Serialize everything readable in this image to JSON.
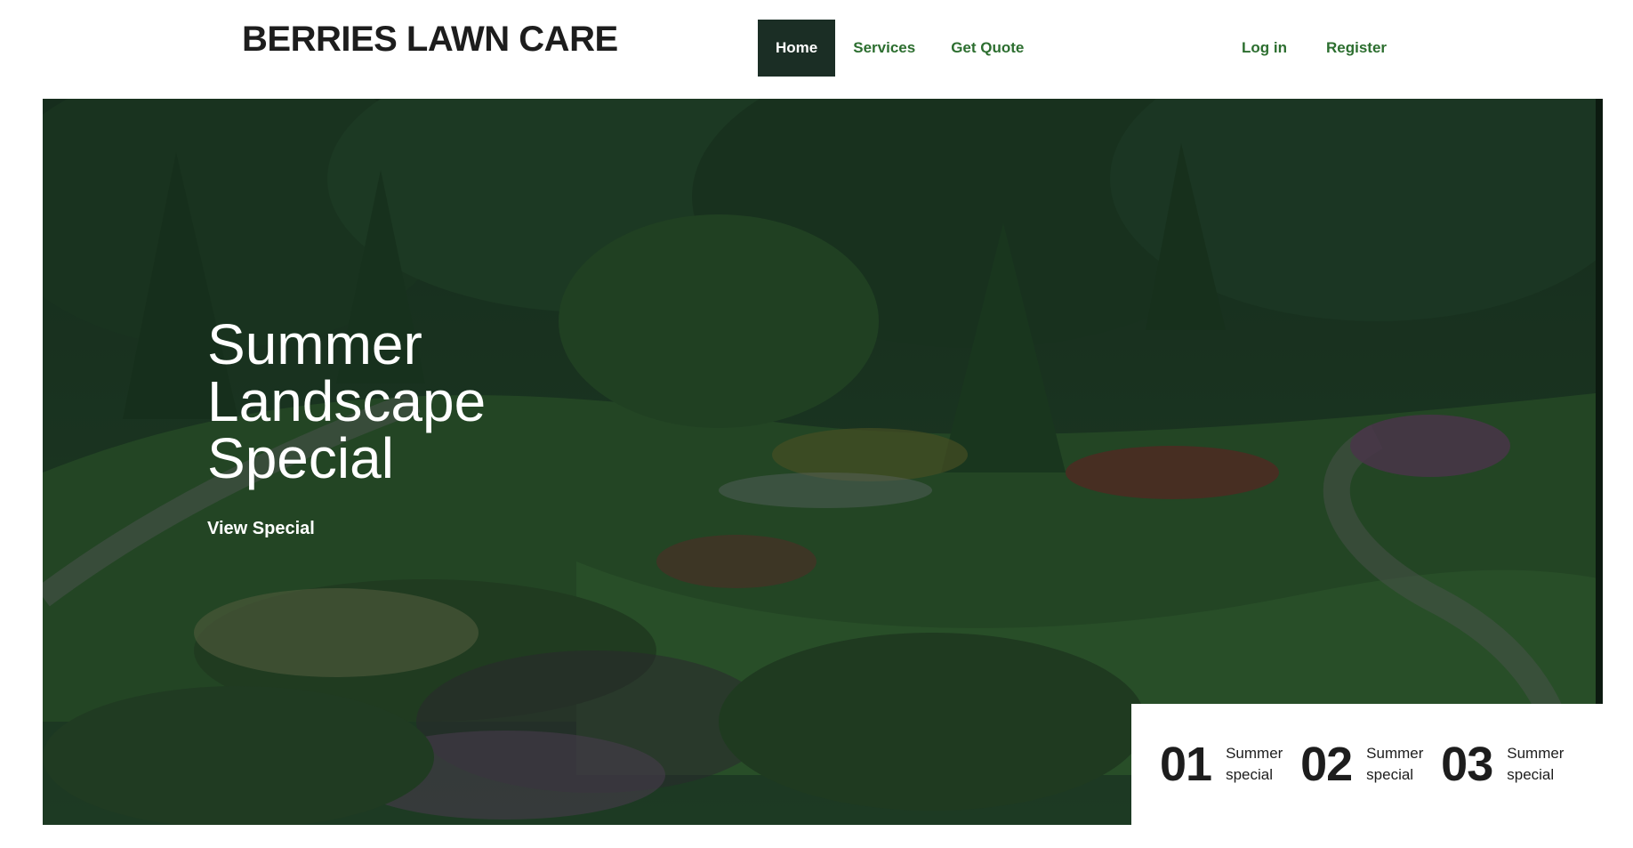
{
  "header": {
    "brand": "BERRIES LAWN CARE",
    "nav": [
      {
        "label": "Home",
        "active": true
      },
      {
        "label": "Services",
        "active": false
      },
      {
        "label": "Get Quote",
        "active": false
      }
    ],
    "auth": [
      {
        "label": "Log in"
      },
      {
        "label": "Register"
      }
    ]
  },
  "hero": {
    "title": "Summer Landscape Special",
    "cta": "View Special"
  },
  "specials": [
    {
      "number": "01",
      "label": "Summer special"
    },
    {
      "number": "02",
      "label": "Summer special"
    },
    {
      "number": "03",
      "label": "Summer special"
    }
  ],
  "colors": {
    "nav_active_bg": "#1b2e25",
    "link_green": "#2c6e2f",
    "text_dark": "#1d1d1d"
  }
}
